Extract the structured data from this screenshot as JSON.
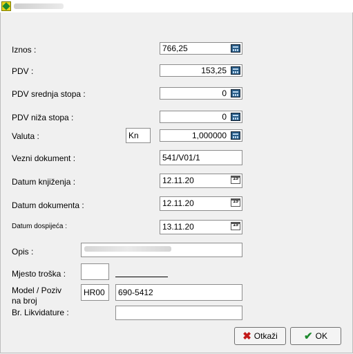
{
  "form": {
    "iznos": {
      "label": "Iznos :",
      "value": "766,25"
    },
    "pdv": {
      "label": "PDV :",
      "value": "153,25"
    },
    "pdv_srednja": {
      "label": "PDV srednja stopa :",
      "value": "0"
    },
    "pdv_niza": {
      "label": "PDV niža stopa :",
      "value": "0"
    },
    "valuta": {
      "label": "Valuta :",
      "code": "Kn",
      "rate": "1,000000"
    },
    "vezni_dokument": {
      "label": "Vezni dokument :",
      "value": "541/V01/1"
    },
    "datum_knjizenja": {
      "label": "Datum knjiženja :",
      "value": "12.11.20"
    },
    "datum_dokumenta": {
      "label": "Datum dokumenta :",
      "value": "12.11.20"
    },
    "datum_dospijeca": {
      "label": "Datum dospijeća :",
      "value": "13.11.20"
    },
    "opis": {
      "label": "Opis :"
    },
    "mjesto_troska": {
      "label": "Mjesto troška :",
      "value": ""
    },
    "model_poziv": {
      "label_line1": "Model / Poziv",
      "label_line2": "na broj",
      "model": "HR00",
      "poziv": "690-5412"
    },
    "br_likvidature": {
      "label": "Br. Likvidature :",
      "value": ""
    }
  },
  "icons": {
    "calendar_glyph": "15",
    "calc": "calculator-icon"
  },
  "buttons": {
    "cancel": "Otkaži",
    "ok": "OK"
  }
}
